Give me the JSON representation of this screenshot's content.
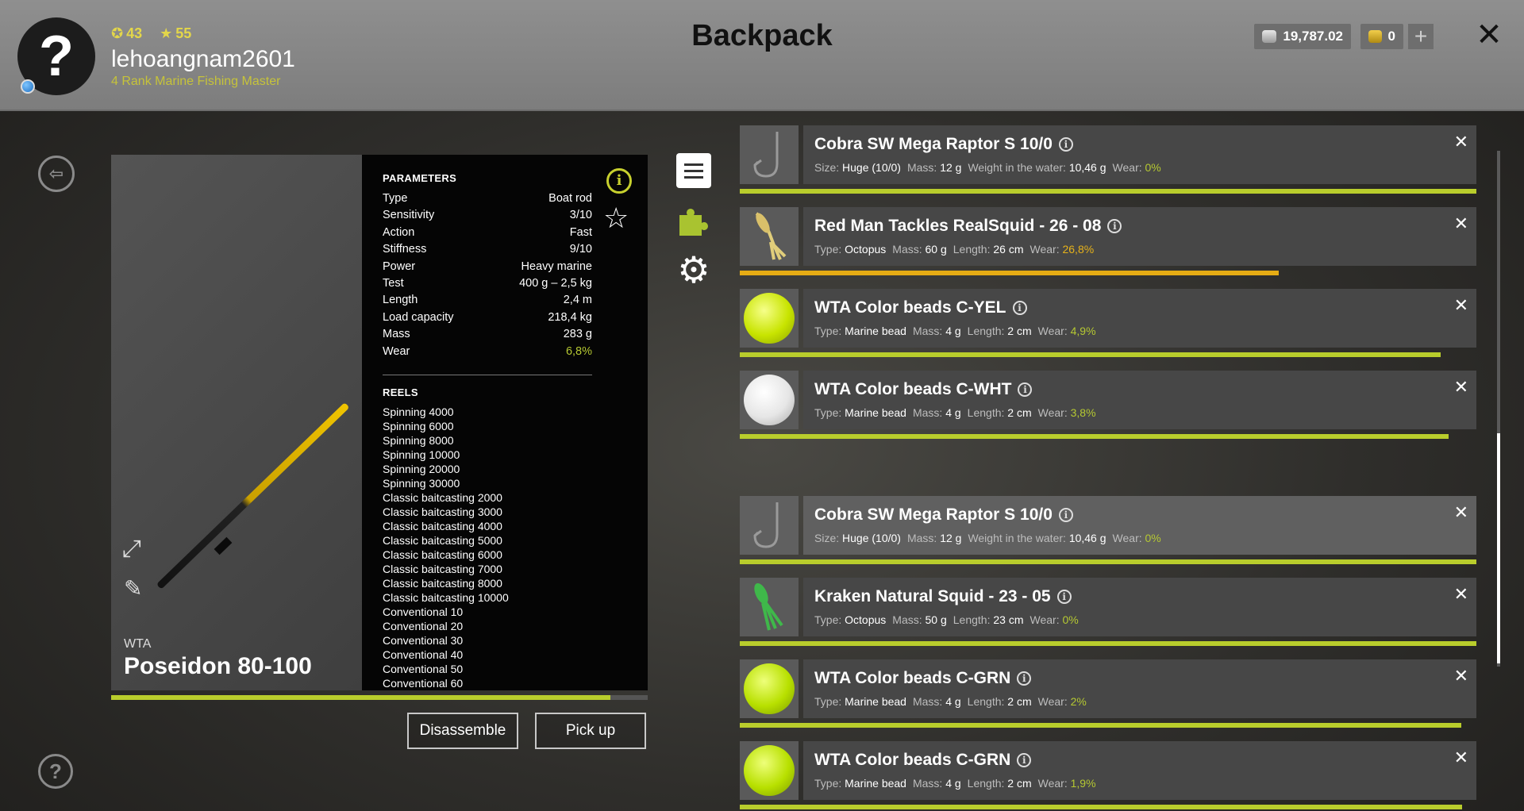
{
  "header": {
    "title": "Backpack",
    "level": "43",
    "stars": "55",
    "username": "lehoangnam2601",
    "rank": "4 Rank Marine Fishing Master",
    "silver": "19,787.02",
    "gold": "0",
    "plus": "+",
    "close": "✕",
    "avatar": "?"
  },
  "rod": {
    "brand": "WTA",
    "name": "Poseidon 80-100",
    "wear_fraction": 0.93
  },
  "parameters": {
    "title": "PARAMETERS",
    "rows": [
      {
        "label": "Type",
        "value": "Boat rod"
      },
      {
        "label": "Sensitivity",
        "value": "3/10"
      },
      {
        "label": "Action",
        "value": "Fast"
      },
      {
        "label": "Stiffness",
        "value": "9/10"
      },
      {
        "label": "Power",
        "value": "Heavy marine"
      },
      {
        "label": "Test",
        "value": "400 g – 2,5 kg"
      },
      {
        "label": "Length",
        "value": "2,4 m"
      },
      {
        "label": "Load capacity",
        "value": "218,4 kg"
      },
      {
        "label": "Mass",
        "value": "283 g"
      },
      {
        "label": "Wear",
        "value": "6,8%"
      }
    ]
  },
  "reels": {
    "title": "REELS",
    "items": [
      "Spinning 4000",
      "Spinning 6000",
      "Spinning 8000",
      "Spinning 10000",
      "Spinning 20000",
      "Spinning 30000",
      "Classic baitcasting 2000",
      "Classic baitcasting 3000",
      "Classic baitcasting 4000",
      "Classic baitcasting 5000",
      "Classic baitcasting 6000",
      "Classic baitcasting 7000",
      "Classic baitcasting 8000",
      "Classic baitcasting 10000",
      "Conventional 10",
      "Conventional 20",
      "Conventional 30",
      "Conventional 40",
      "Conventional 50",
      "Conventional 60"
    ]
  },
  "buttons": {
    "disassemble": "Disassemble",
    "pickup": "Pick up"
  },
  "icons": {
    "info": "i",
    "star": "☆",
    "gear": "⚙",
    "back": "⇦",
    "help": "?",
    "expand": "⤢",
    "pen": "✎"
  },
  "items": [
    {
      "name": "Cobra SW Mega Raptor S 10/0",
      "kind": "hook",
      "f1l": "Size:",
      "f1v": "Huge (10/0)",
      "f2l": "Mass:",
      "f2v": "12 g",
      "f3l": "Weight in the water:",
      "f3v": "10,46 g",
      "wear": "0%",
      "wear_fraction": 1.0
    },
    {
      "name": "Red Man Tackles RealSquid - 26 - 08",
      "kind": "squid-yellow",
      "f1l": "Type:",
      "f1v": "Octopus",
      "f2l": "Mass:",
      "f2v": "60 g",
      "f3l": "Length:",
      "f3v": "26 cm",
      "wear": "26,8%",
      "wear_fraction": 0.732
    },
    {
      "name": "WTA Color beads C-YEL",
      "kind": "bead-yellow",
      "f1l": "Type:",
      "f1v": "Marine bead",
      "f2l": "Mass:",
      "f2v": "4 g",
      "f3l": "Length:",
      "f3v": "2 cm",
      "wear": "4,9%",
      "wear_fraction": 0.951
    },
    {
      "name": "WTA Color beads C-WHT",
      "kind": "bead-white",
      "f1l": "Type:",
      "f1v": "Marine bead",
      "f2l": "Mass:",
      "f2v": "4 g",
      "f3l": "Length:",
      "f3v": "2 cm",
      "wear": "3,8%",
      "wear_fraction": 0.962
    },
    {
      "name": "Cobra SW Mega Raptor S 10/0",
      "kind": "hook",
      "f1l": "Size:",
      "f1v": "Huge (10/0)",
      "f2l": "Mass:",
      "f2v": "12 g",
      "f3l": "Weight in the water:",
      "f3v": "10,46 g",
      "wear": "0%",
      "wear_fraction": 1.0
    },
    {
      "name": "Kraken Natural Squid - 23 - 05",
      "kind": "squid-green",
      "f1l": "Type:",
      "f1v": "Octopus",
      "f2l": "Mass:",
      "f2v": "50 g",
      "f3l": "Length:",
      "f3v": "23 cm",
      "wear": "0%",
      "wear_fraction": 1.0
    },
    {
      "name": "WTA Color beads C-GRN",
      "kind": "bead-green",
      "f1l": "Type:",
      "f1v": "Marine bead",
      "f2l": "Mass:",
      "f2v": "4 g",
      "f3l": "Length:",
      "f3v": "2 cm",
      "wear": "2%",
      "wear_fraction": 0.98
    },
    {
      "name": "WTA Color beads C-GRN",
      "kind": "bead-green",
      "f1l": "Type:",
      "f1v": "Marine bead",
      "f2l": "Mass:",
      "f2v": "4 g",
      "f3l": "Length:",
      "f3v": "2 cm",
      "wear": "1,9%",
      "wear_fraction": 0.981
    }
  ],
  "colors": {
    "accent_green": "#b9cd2c",
    "accent_orange": "#e6ac14"
  }
}
